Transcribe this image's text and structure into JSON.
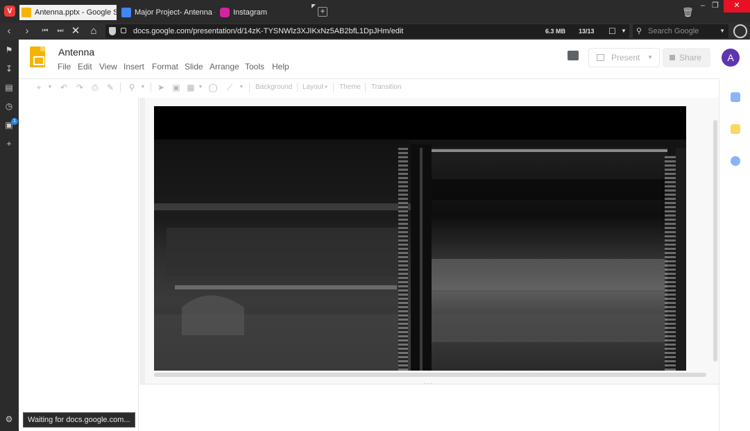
{
  "browser": {
    "logo_letter": "V",
    "tabs": [
      {
        "title": "Antenna.pptx - Google Slid",
        "active": true,
        "icon": "slides-icon",
        "color": "#f4b400"
      },
      {
        "title": "Major Project- Antenna - G",
        "active": false,
        "icon": "docs-icon",
        "color": "#4285f4"
      },
      {
        "title": "Instagram",
        "active": false,
        "icon": "instagram-icon",
        "color": "#d6249f"
      }
    ],
    "url": "docs.google.com/presentation/d/14zK-TYSNWlz3XJIKxNz5AB2bfL1DpJHm/edit",
    "page_size": "6.3 MB",
    "load_count": "13/13",
    "search_placeholder": "Search Google",
    "status": "Waiting for docs.google.com..."
  },
  "slides": {
    "doc_title": "Antenna",
    "menu": [
      "File",
      "Edit",
      "View",
      "Insert",
      "Format",
      "Slide",
      "Arrange",
      "Tools",
      "Help"
    ],
    "present_label": "Present",
    "share_label": "Share",
    "avatar_letter": "A",
    "toolbar_text": [
      "Background",
      "Layout",
      "Theme",
      "Transition"
    ]
  },
  "colors": {
    "chrome_dark": "#2b2b2b",
    "vivaldi_red": "#ef3939",
    "slides_yellow": "#f4b400",
    "avatar_purple": "#5e35b1"
  }
}
